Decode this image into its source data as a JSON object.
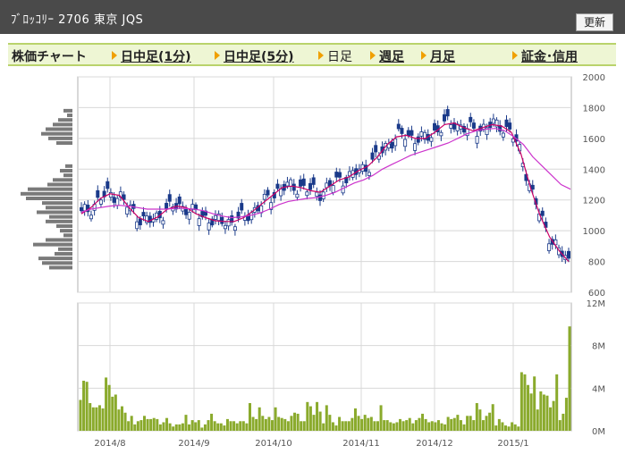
{
  "header": {
    "title": "ﾌﾞﾛｯｺﾘｰ  2706  東京  JQS",
    "refresh_label": "更新"
  },
  "menu": {
    "label": "株価チャート",
    "items": [
      {
        "label": "日中足(1分)",
        "link": true
      },
      {
        "label": "日中足(5分)",
        "link": true
      },
      {
        "label": "日足",
        "link": false
      },
      {
        "label": "週足",
        "link": true
      },
      {
        "label": "月足",
        "link": true
      },
      {
        "label": "証金･信用",
        "link": true
      }
    ]
  },
  "chart_data": [
    {
      "type": "candlestick",
      "title": "",
      "y_ticks": [
        "2000",
        "1800",
        "1600",
        "1400",
        "1200",
        "1000",
        "800",
        "600"
      ],
      "ylim": [
        600,
        2000
      ],
      "x_ticks": [
        "2014/8",
        "2014/9",
        "2014/10",
        "2014/11",
        "2014/12",
        "2015/1"
      ],
      "moving_averages": [
        {
          "color": "#cc0066",
          "values": [
            1110,
            1150,
            1210,
            1240,
            1230,
            1150,
            1085,
            1060,
            1090,
            1140,
            1160,
            1150,
            1110,
            1085,
            1065,
            1060,
            1060,
            1085,
            1130,
            1180,
            1230,
            1280,
            1290,
            1280,
            1260,
            1250,
            1290,
            1330,
            1350,
            1390,
            1420,
            1480,
            1560,
            1610,
            1620,
            1600,
            1600,
            1640,
            1690,
            1700,
            1670,
            1650,
            1670,
            1690,
            1680,
            1640,
            1500,
            1280,
            1100,
            960,
            870,
            800
          ]
        },
        {
          "color": "#cc33cc",
          "values": [
            1120,
            1140,
            1150,
            1160,
            1165,
            1160,
            1150,
            1140,
            1140,
            1140,
            1145,
            1145,
            1140,
            1130,
            1110,
            1095,
            1085,
            1090,
            1100,
            1115,
            1140,
            1170,
            1190,
            1200,
            1210,
            1215,
            1230,
            1250,
            1280,
            1310,
            1330,
            1360,
            1400,
            1430,
            1460,
            1490,
            1510,
            1530,
            1550,
            1570,
            1600,
            1630,
            1650,
            1660,
            1665,
            1650,
            1610,
            1560,
            1480,
            1420,
            1360,
            1300,
            1270
          ]
        }
      ],
      "price_histogram_bins": [
        {
          "price": 1780,
          "length": 10
        },
        {
          "price": 1750,
          "length": 6
        },
        {
          "price": 1720,
          "length": 16
        },
        {
          "price": 1690,
          "length": 22
        },
        {
          "price": 1660,
          "length": 30
        },
        {
          "price": 1630,
          "length": 35
        },
        {
          "price": 1600,
          "length": 27
        },
        {
          "price": 1570,
          "length": 18
        },
        {
          "price": 1420,
          "length": 8
        },
        {
          "price": 1390,
          "length": 14
        },
        {
          "price": 1360,
          "length": 10
        },
        {
          "price": 1330,
          "length": 22
        },
        {
          "price": 1300,
          "length": 28
        },
        {
          "price": 1270,
          "length": 50
        },
        {
          "price": 1240,
          "length": 58
        },
        {
          "price": 1210,
          "length": 52
        },
        {
          "price": 1180,
          "length": 34
        },
        {
          "price": 1150,
          "length": 30
        },
        {
          "price": 1120,
          "length": 40
        },
        {
          "price": 1090,
          "length": 26
        },
        {
          "price": 1060,
          "length": 30
        },
        {
          "price": 1030,
          "length": 18
        },
        {
          "price": 1000,
          "length": 14
        },
        {
          "price": 970,
          "length": 10
        },
        {
          "price": 940,
          "length": 30
        },
        {
          "price": 910,
          "length": 44
        },
        {
          "price": 880,
          "length": 16
        },
        {
          "price": 850,
          "length": 20
        },
        {
          "price": 820,
          "length": 38
        },
        {
          "price": 790,
          "length": 34
        },
        {
          "price": 760,
          "length": 26
        }
      ]
    },
    {
      "type": "bar",
      "title": "",
      "y_ticks": [
        "12M",
        "8M",
        "4M",
        "0M"
      ],
      "ylim": [
        0,
        12
      ],
      "unit": "M",
      "values": [
        2.9,
        4.7,
        4.6,
        2.6,
        2.2,
        2.2,
        2.4,
        2.1,
        5.0,
        4.3,
        3.2,
        3.4,
        2.0,
        2.3,
        1.7,
        0.9,
        1.4,
        0.6,
        0.9,
        1.0,
        1.4,
        1.1,
        1.1,
        1.2,
        1.1,
        0.6,
        0.8,
        1.2,
        0.7,
        0.4,
        0.6,
        0.6,
        0.7,
        1.5,
        0.6,
        1.0,
        0.8,
        1.0,
        0.3,
        0.6,
        1.0,
        1.6,
        0.9,
        0.7,
        0.7,
        0.5,
        1.1,
        0.9,
        0.9,
        0.7,
        0.9,
        0.9,
        0.7,
        2.6,
        1.3,
        1.1,
        2.2,
        1.4,
        1.1,
        1.3,
        1.0,
        2.2,
        1.3,
        1.2,
        1.1,
        0.9,
        1.4,
        1.7,
        1.6,
        0.9,
        0.9,
        2.7,
        2.3,
        1.5,
        2.7,
        1.8,
        0.7,
        2.4,
        1.5,
        0.8,
        0.5,
        1.3,
        0.9,
        0.9,
        0.9,
        1.2,
        2.1,
        1.4,
        1.1,
        1.5,
        1.2,
        1.3,
        0.9,
        0.9,
        2.4,
        1.0,
        1.0,
        0.8,
        0.7,
        0.8,
        1.1,
        0.9,
        1.0,
        1.2,
        0.7,
        1.0,
        1.2,
        1.6,
        1.1,
        0.8,
        0.9,
        0.8,
        1.0,
        0.7,
        0.6,
        1.3,
        1.1,
        1.2,
        1.5,
        1.0,
        0.6,
        1.4,
        1.4,
        1.0,
        2.6,
        2.0,
        1.0,
        1.4,
        1.7,
        2.5,
        0.5,
        1.1,
        0.8,
        0.5,
        0.4,
        0.8,
        0.6,
        0.4,
        5.5,
        5.3,
        4.3,
        3.5,
        5.1,
        2.0,
        3.7,
        3.4,
        3.3,
        2.2,
        2.8,
        5.3,
        1.0,
        1.6,
        3.1,
        9.8
      ]
    }
  ]
}
